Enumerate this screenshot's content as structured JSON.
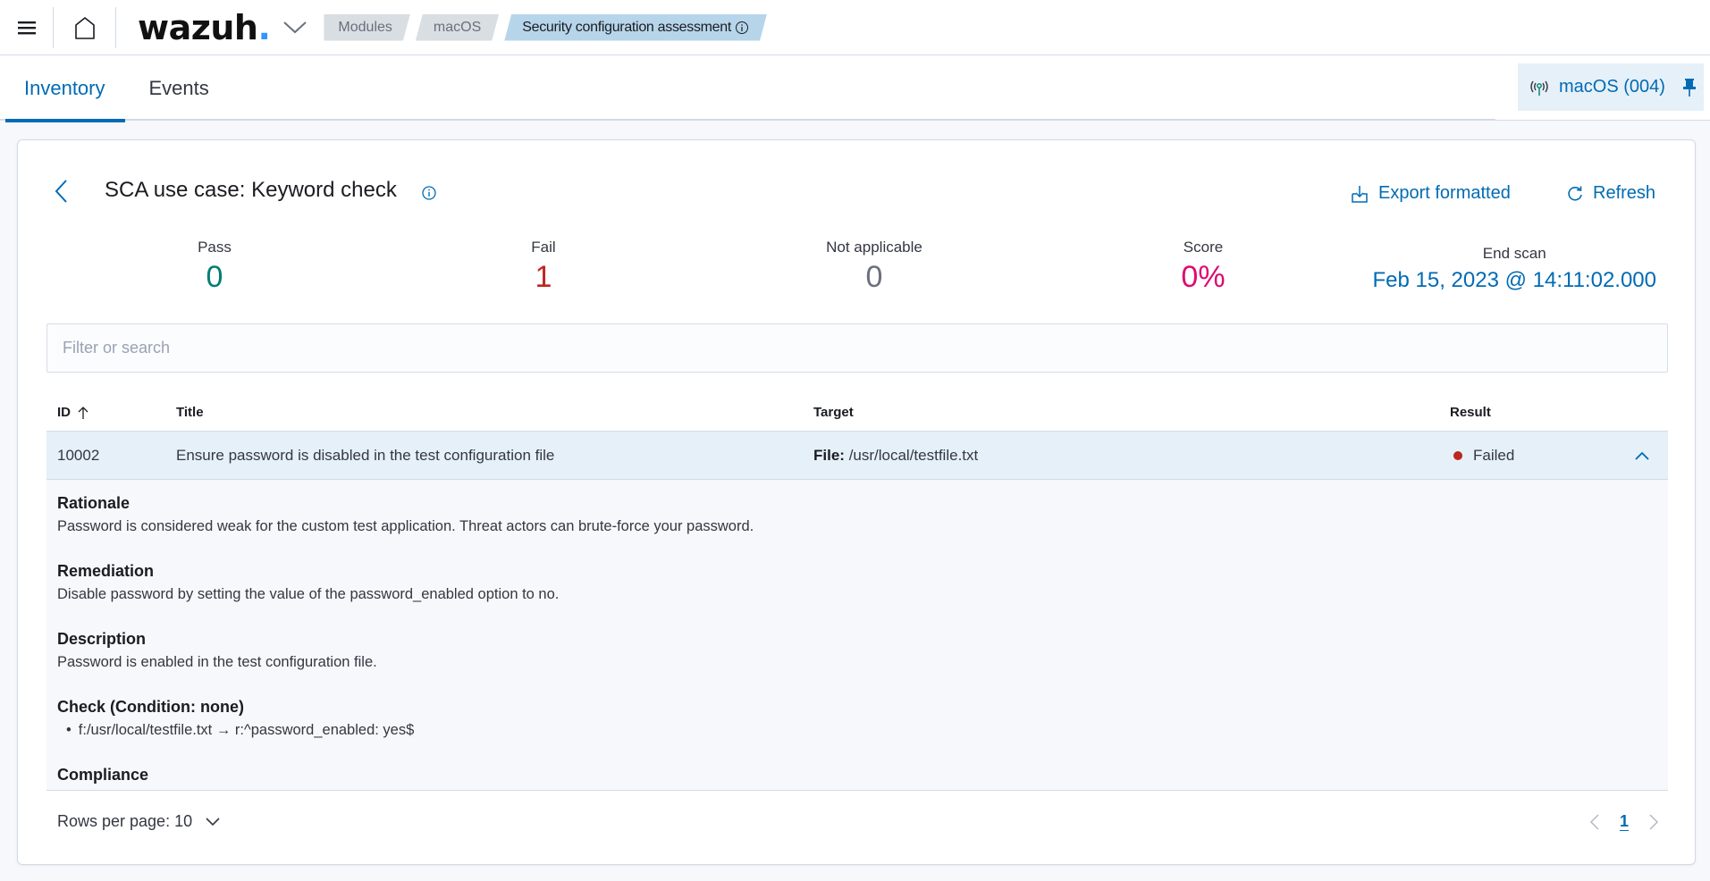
{
  "header": {
    "logo_text": "wazuh",
    "logo_dot": ".",
    "breadcrumbs": [
      {
        "label": "Modules"
      },
      {
        "label": "macOS"
      },
      {
        "label": "Security configuration assessment"
      }
    ]
  },
  "tabs": [
    {
      "label": "Inventory",
      "active": true
    },
    {
      "label": "Events",
      "active": false
    }
  ],
  "agent": {
    "label": "macOS (004)"
  },
  "panel": {
    "title": "SCA use case: Keyword check",
    "actions": {
      "export": "Export formatted",
      "refresh": "Refresh"
    },
    "stats": {
      "pass": {
        "label": "Pass",
        "value": "0",
        "color": "#017d73"
      },
      "fail": {
        "label": "Fail",
        "value": "1",
        "color": "#bd271e"
      },
      "not_applicable": {
        "label": "Not applicable",
        "value": "0",
        "color": "#69707d"
      },
      "score": {
        "label": "Score",
        "value": "0%",
        "color": "#dd0a73"
      },
      "end_scan": {
        "label": "End scan",
        "value": "Feb 15, 2023 @ 14:11:02.000"
      }
    },
    "search": {
      "placeholder": "Filter or search",
      "value": ""
    },
    "table": {
      "columns": {
        "id": "ID",
        "title": "Title",
        "target": "Target",
        "result": "Result"
      },
      "rows": [
        {
          "id": "10002",
          "title": "Ensure password is disabled in the test configuration file",
          "target_label": "File:",
          "target_value": "/usr/local/testfile.txt",
          "result": "Failed"
        }
      ],
      "detail": {
        "rationale_h": "Rationale",
        "rationale": "Password is considered weak for the custom test application. Threat actors can brute-force your password.",
        "remediation_h": "Remediation",
        "remediation": "Disable password by setting the value of the password_enabled option to no.",
        "description_h": "Description",
        "description": "Password is enabled in the test configuration file.",
        "check_h": "Check (Condition: none)",
        "check_items": [
          "f:/usr/local/testfile.txt → r:^password_enabled: yes$"
        ],
        "compliance_h": "Compliance"
      }
    },
    "pagination": {
      "rows_per_page": "Rows per page: 10",
      "current_page": "1"
    }
  },
  "icons": {
    "menu": "hamburger-icon",
    "home": "home-icon",
    "chevron": "chevron-down-icon",
    "info": "info-icon",
    "agent": "antenna-icon",
    "pin": "pin-icon",
    "back": "chevron-left-icon",
    "export": "download-icon",
    "refresh": "refresh-icon",
    "sort": "arrow-up-icon",
    "expand": "chevron-up-icon"
  }
}
